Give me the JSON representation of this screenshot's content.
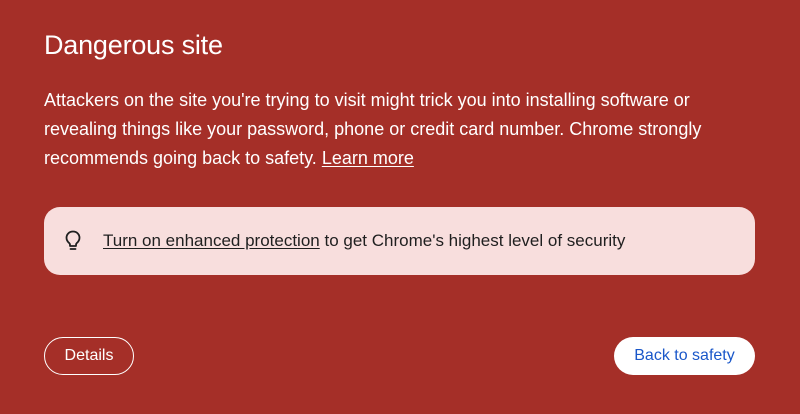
{
  "interstitial": {
    "title": "Dangerous site",
    "message": "Attackers on the site you're trying to visit might trick you into installing software or revealing things like your password, phone or credit card number. Chrome strongly recommends going back to safety. ",
    "learn_more": "Learn more"
  },
  "banner": {
    "icon": "lightbulb-icon",
    "link_text": "Turn on enhanced protection",
    "suffix_text": " to get Chrome's highest level of security"
  },
  "buttons": {
    "details_label": "Details",
    "back_label": "Back to safety"
  },
  "colors": {
    "background": "#a52f28",
    "banner_background": "#f8dedd",
    "back_button_text": "#1a57c9"
  }
}
